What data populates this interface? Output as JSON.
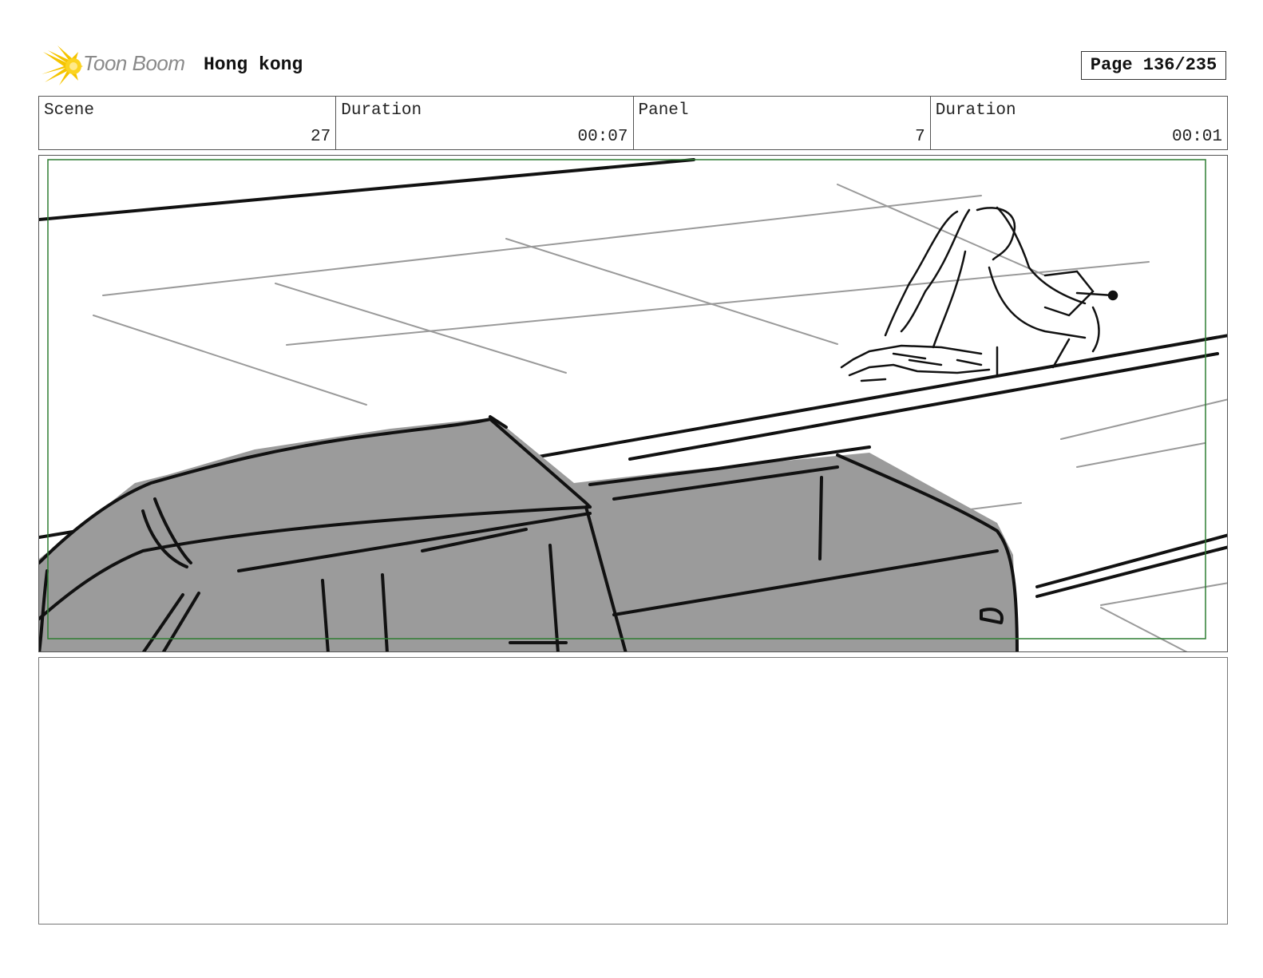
{
  "header": {
    "logo_text": "Toon Boom",
    "project_title": "Hong kong",
    "page_label": "Page 136/235"
  },
  "info": {
    "scene_label": "Scene",
    "scene_value": "27",
    "scene_duration_label": "Duration",
    "scene_duration_value": "00:07",
    "panel_label": "Panel",
    "panel_value": "7",
    "panel_duration_label": "Duration",
    "panel_duration_value": "00:01"
  },
  "colors": {
    "safe_frame": "#2e7d32",
    "car_fill": "#9b9b9b",
    "logo_star": "#f5c400"
  },
  "icons": {
    "logo": "toon-boom-star-icon"
  }
}
